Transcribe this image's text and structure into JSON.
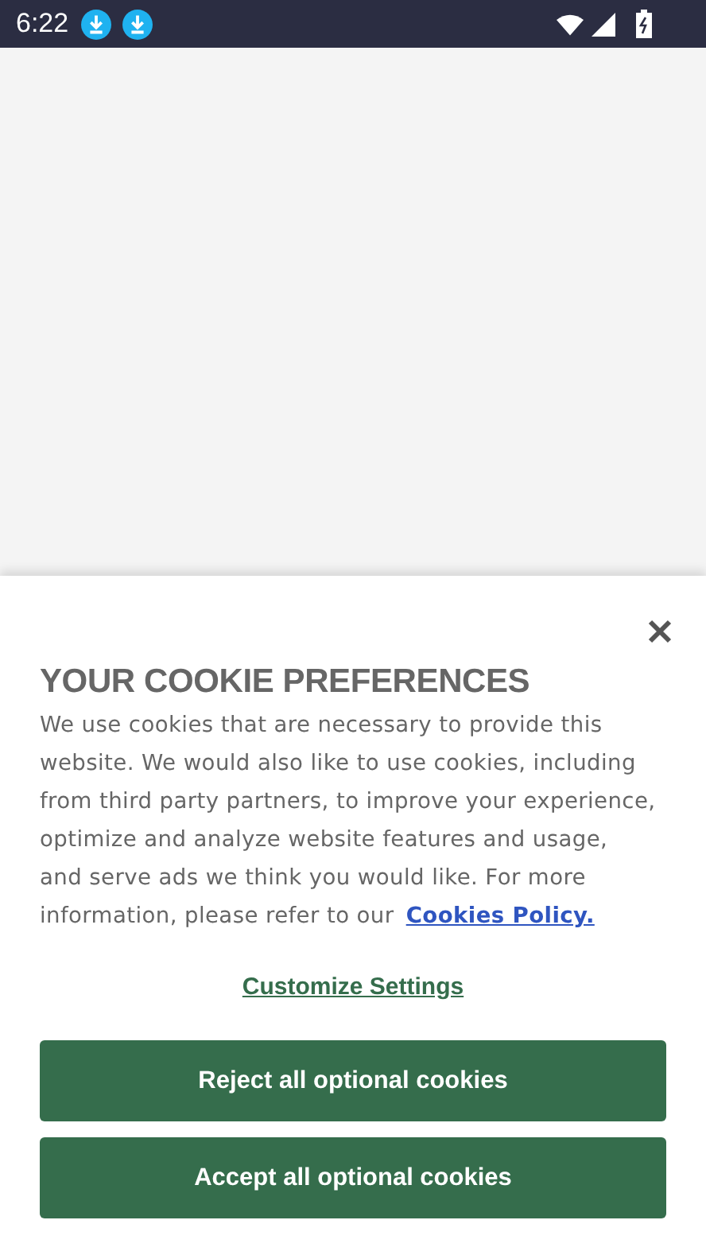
{
  "status_bar": {
    "time": "6:22",
    "notifications": [
      {
        "kind": "download"
      },
      {
        "kind": "download"
      }
    ]
  },
  "cookie_panel": {
    "title": "YOUR COOKIE PREFERENCES",
    "body": "We use cookies that are necessary to provide this website. We would also like to use cookies, including from third party partners, to improve your experience, optimize and analyze website features and usage, and serve ads we think you would like. For more information, please refer to our",
    "policy_link": "Cookies Policy.",
    "customize_link": "Customize Settings",
    "buttons": [
      "Reject all optional cookies",
      "Accept all optional cookies"
    ]
  }
}
